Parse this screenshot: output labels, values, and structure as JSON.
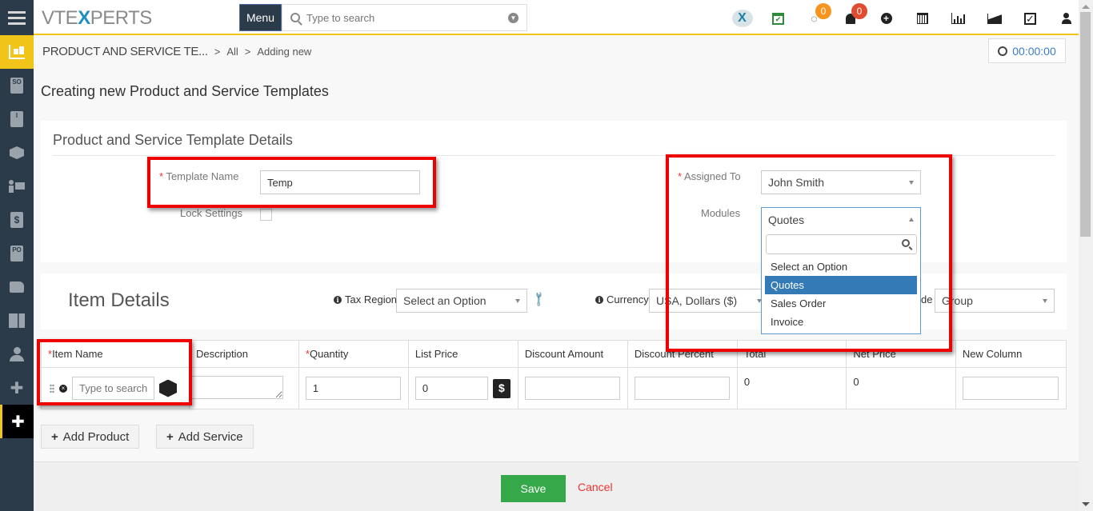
{
  "topbar": {
    "logo": {
      "pre": "VTE",
      "x": "X",
      "post": "PERTS"
    },
    "menu_label": "Menu",
    "search_placeholder": "Type to search",
    "icons": [
      {
        "name": "vtexperts-x-icon",
        "glyph": "X"
      },
      {
        "name": "calendar-check-icon",
        "glyph": "✔"
      },
      {
        "name": "chat-icon",
        "glyph": "💬",
        "badge": "0",
        "badge_color": "#f7941d"
      },
      {
        "name": "bell-icon",
        "glyph": "🔔",
        "badge": "0",
        "badge_color": "#e04c2f"
      },
      {
        "name": "plus-circle-icon",
        "glyph": "⊕"
      },
      {
        "name": "calendar-icon",
        "glyph": "▦"
      },
      {
        "name": "bar-chart-icon",
        "glyph": "📊"
      },
      {
        "name": "area-chart-icon",
        "glyph": "◭"
      },
      {
        "name": "checkbox-icon",
        "glyph": "☑"
      },
      {
        "name": "user-icon",
        "glyph": "👤"
      }
    ]
  },
  "sidebar": {
    "items": [
      {
        "name": "products-cart-icon",
        "glyph": "🛒",
        "state": "active"
      },
      {
        "name": "sales-order-icon",
        "glyph": "SO"
      },
      {
        "name": "invoice-icon",
        "glyph": "I"
      },
      {
        "name": "box-icon",
        "glyph": "❒"
      },
      {
        "name": "presentation-icon",
        "glyph": "▣"
      },
      {
        "name": "price-book-icon",
        "glyph": "$"
      },
      {
        "name": "purchase-order-icon",
        "glyph": "PO"
      },
      {
        "name": "service-icon",
        "glyph": "✋"
      },
      {
        "name": "vendors-building-icon",
        "glyph": "▥"
      },
      {
        "name": "contacts-person-icon",
        "glyph": "●"
      },
      {
        "name": "extensions-puzzle-icon",
        "glyph": "✚"
      },
      {
        "name": "current-puzzle-icon",
        "glyph": "✚",
        "state": "current"
      }
    ]
  },
  "breadcrumb": {
    "module": "PRODUCT AND SERVICE TE...",
    "sep": ">",
    "items": [
      "All",
      "Adding new"
    ]
  },
  "timer": "00:00:00",
  "page_title": "Creating new Product and Service Templates",
  "details": {
    "heading": "Product and Service Template Details",
    "template_name_label": "Template Name",
    "template_name_value": "Temp",
    "lock_settings_label": "Lock Settings",
    "lock_settings_checked": false,
    "assigned_to_label": "Assigned To",
    "assigned_to_value": "John Smith",
    "modules_label": "Modules",
    "modules_value": "Quotes",
    "modules_options": [
      "Select an Option",
      "Quotes",
      "Sales Order",
      "Invoice"
    ],
    "modules_selected_index": 1
  },
  "item_details": {
    "heading": "Item Details",
    "tax_region_label": "Tax Region",
    "tax_region_value": "Select an Option",
    "currency_label": "Currency",
    "currency_value": "USA, Dollars ($)",
    "tax_mode_label_visible": "de",
    "tax_mode_value": "Group"
  },
  "table": {
    "headers": [
      "Item Name",
      "Description",
      "Quantity",
      "List Price",
      "Discount Amount",
      "Discount Percent",
      "Total",
      "Net Price",
      "New Column"
    ],
    "required": [
      true,
      false,
      true,
      false,
      false,
      false,
      false,
      false,
      false
    ],
    "row": {
      "item_placeholder": "Type to search",
      "description": "",
      "quantity": "1",
      "list_price": "0",
      "discount_amount": "",
      "discount_percent": "",
      "total": "0",
      "net_price": "0",
      "new_column": ""
    }
  },
  "buttons": {
    "add_product": "Add Product",
    "add_service": "Add Service",
    "save": "Save",
    "cancel": "Cancel"
  },
  "colors": {
    "sidebar_bg": "#2c3b49",
    "accent_yellow": "#f0c419",
    "save_green": "#35a84a",
    "cancel_red": "#e33333",
    "selected_option": "#337ab7",
    "annotation_red": "#ee0000",
    "timer_blue": "#3a7cc6"
  }
}
